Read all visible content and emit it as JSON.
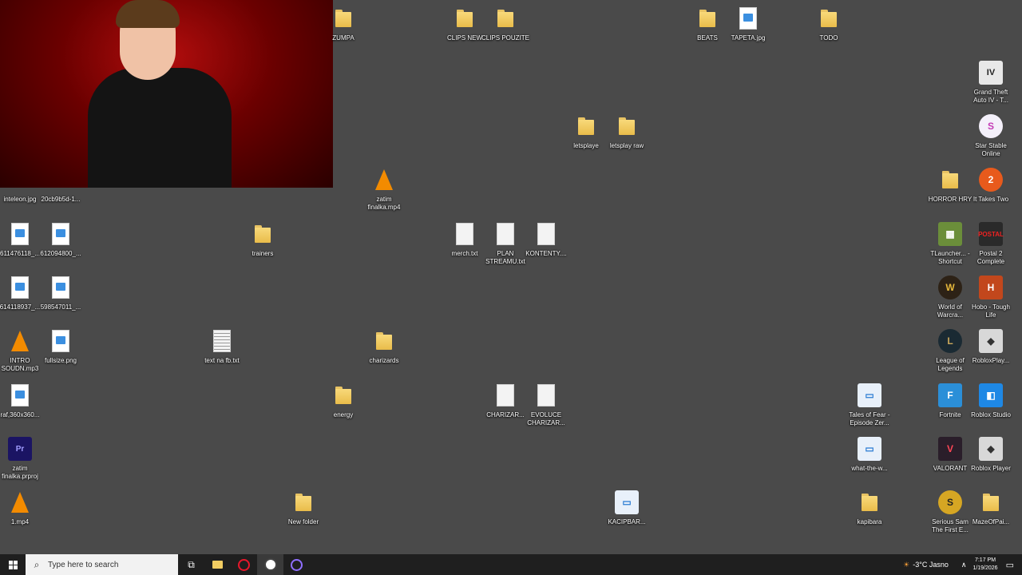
{
  "desktop": {
    "icons": [
      {
        "label": "ZUMPA",
        "type": "folder"
      },
      {
        "label": "CLIPS NEW",
        "type": "folder"
      },
      {
        "label": "CLIPS POUZITE",
        "type": "folder"
      },
      {
        "label": "BEATS",
        "type": "folder"
      },
      {
        "label": "TAPETA.jpg",
        "type": "image"
      },
      {
        "label": "TODO",
        "type": "folder"
      },
      {
        "label": "Grand Theft Auto IV - T...",
        "type": "app"
      },
      {
        "label": "Star Stable Online",
        "type": "app"
      },
      {
        "label": "letsplaye",
        "type": "folder"
      },
      {
        "label": "letsplay raw",
        "type": "folder"
      },
      {
        "label": "inteleon.jpg",
        "type": "image"
      },
      {
        "label": "20cb9b5d-1...",
        "type": "image"
      },
      {
        "label": "zatim finalka.mp4",
        "type": "vlc"
      },
      {
        "label": "HORROR HRY",
        "type": "folder"
      },
      {
        "label": "It Takes Two",
        "type": "app"
      },
      {
        "label": "611476118_...",
        "type": "image"
      },
      {
        "label": "612094800_...",
        "type": "image"
      },
      {
        "label": "trainers",
        "type": "folder"
      },
      {
        "label": "merch.txt",
        "type": "doc"
      },
      {
        "label": "PLAN STREAMU.txt",
        "type": "doc"
      },
      {
        "label": "KONTENTY....",
        "type": "doc"
      },
      {
        "label": "TLauncher... - Shortcut",
        "type": "app"
      },
      {
        "label": "Postal 2 Complete",
        "type": "app"
      },
      {
        "label": "614118937_...",
        "type": "image"
      },
      {
        "label": "598547011_...",
        "type": "image"
      },
      {
        "label": "World of Warcra...",
        "type": "app"
      },
      {
        "label": "Hobo - Tough Life",
        "type": "app"
      },
      {
        "label": "INTRO SOUDN.mp3",
        "type": "vlc"
      },
      {
        "label": "fullsize.png",
        "type": "image"
      },
      {
        "label": "text na fb.txt",
        "type": "doc"
      },
      {
        "label": "charizards",
        "type": "folder"
      },
      {
        "label": "League of Legends",
        "type": "app"
      },
      {
        "label": "RobloxPlay...",
        "type": "app"
      },
      {
        "label": "raf,360x360...",
        "type": "image"
      },
      {
        "label": "energy",
        "type": "folder"
      },
      {
        "label": "CHARIZAR...",
        "type": "doc"
      },
      {
        "label": "EVOLUCE CHARIZAR...",
        "type": "doc"
      },
      {
        "label": "Tales of Fear - Episode Zer...",
        "type": "app"
      },
      {
        "label": "Fortnite",
        "type": "app"
      },
      {
        "label": "Roblox Studio",
        "type": "app"
      },
      {
        "label": "zatim finalka.prproj",
        "type": "app"
      },
      {
        "label": "what-the-w...",
        "type": "app"
      },
      {
        "label": "VALORANT",
        "type": "app"
      },
      {
        "label": "Roblox Player",
        "type": "app"
      },
      {
        "label": "1.mp4",
        "type": "vlc"
      },
      {
        "label": "New folder",
        "type": "folder"
      },
      {
        "label": "KACIPBAR...",
        "type": "app"
      },
      {
        "label": "kapibara",
        "type": "folder"
      },
      {
        "label": "Serious Sam The First E...",
        "type": "app"
      },
      {
        "label": "MazeOfPai...",
        "type": "folder"
      }
    ]
  },
  "taskbar": {
    "search_placeholder": "Type here to search",
    "weather": "-3°C  Jasno",
    "time": "7:17 PM",
    "date": "1/19/2026"
  },
  "colors": {
    "desktop_bg": "#4a4a4a",
    "taskbar_bg": "#1f1f1f",
    "folder": "#f2cd62"
  }
}
